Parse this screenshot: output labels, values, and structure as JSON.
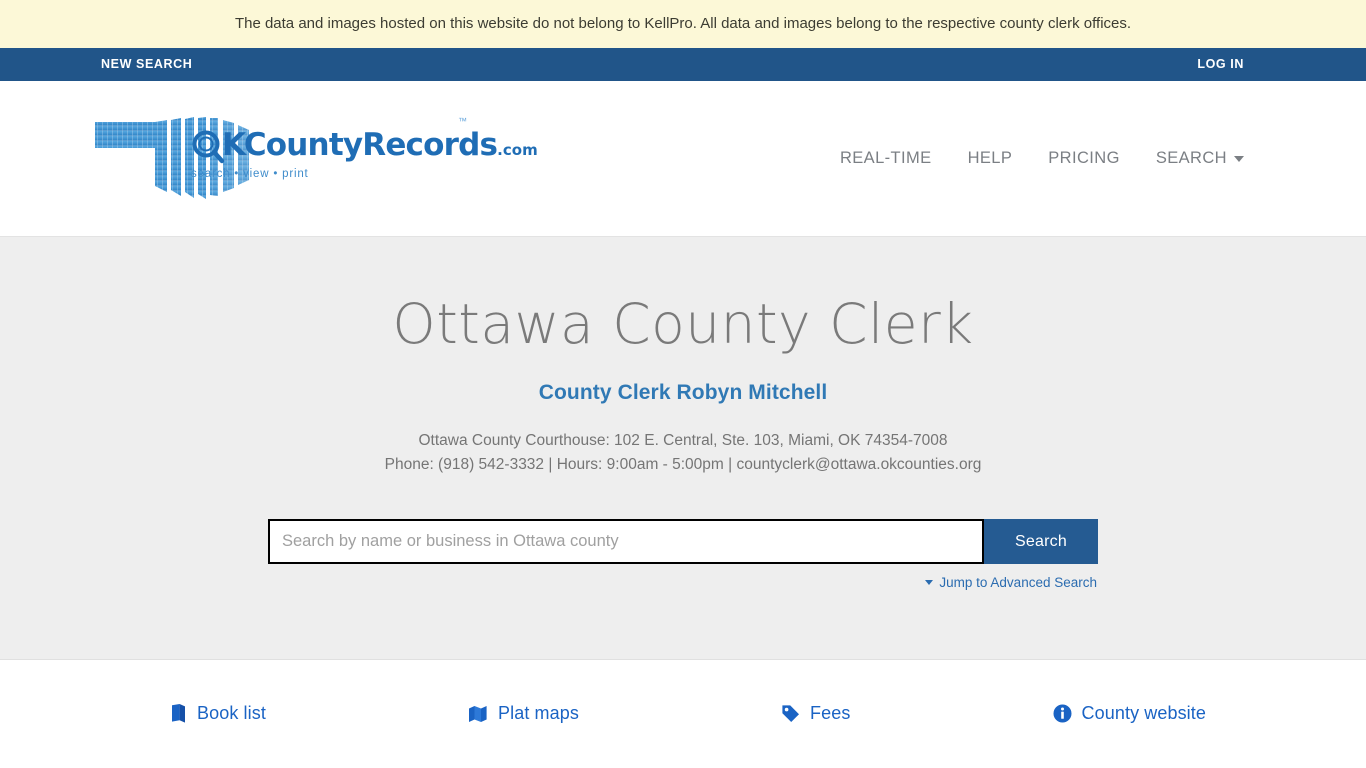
{
  "disclaimer": {
    "text": "The data and images hosted on this website do not belong to KellPro. All data and images belong to the respective county clerk offices."
  },
  "topnav": {
    "new_search": "NEW SEARCH",
    "log_in": "LOG IN"
  },
  "logo": {
    "word_ok": "OK",
    "word_county": "County",
    "word_records": "Records",
    "dotcom": ".com",
    "tagline": "search • view • print",
    "tm": "™"
  },
  "mainnav": {
    "items": [
      {
        "label": "REAL-TIME"
      },
      {
        "label": "HELP"
      },
      {
        "label": "PRICING"
      },
      {
        "label": "SEARCH"
      }
    ]
  },
  "hero": {
    "title": "Ottawa County Clerk",
    "clerk_name": "County Clerk Robyn Mitchell",
    "address": "Ottawa County Courthouse: 102 E. Central, Ste. 103, Miami, OK 74354-7008",
    "contact": "Phone: (918) 542-3332 | Hours: 9:00am - 5:00pm | countyclerk@ottawa.okcounties.org"
  },
  "search": {
    "placeholder": "Search by name or business in Ottawa county",
    "value": "",
    "button_label": "Search",
    "advanced_label": "Jump to Advanced Search"
  },
  "quicklinks": {
    "items": [
      {
        "label": "Book list",
        "icon": "book-icon"
      },
      {
        "label": "Plat maps",
        "icon": "map-icon"
      },
      {
        "label": "Fees",
        "icon": "tag-icon"
      },
      {
        "label": "County website",
        "icon": "info-circle-icon"
      }
    ]
  },
  "colors": {
    "banner_bg": "#fcf8d7",
    "navbar_bg": "#215589",
    "hero_bg": "#eeeeee",
    "accent_blue": "#255b92",
    "link_blue": "#1a63c4",
    "clerk_blue": "#3079b5"
  }
}
